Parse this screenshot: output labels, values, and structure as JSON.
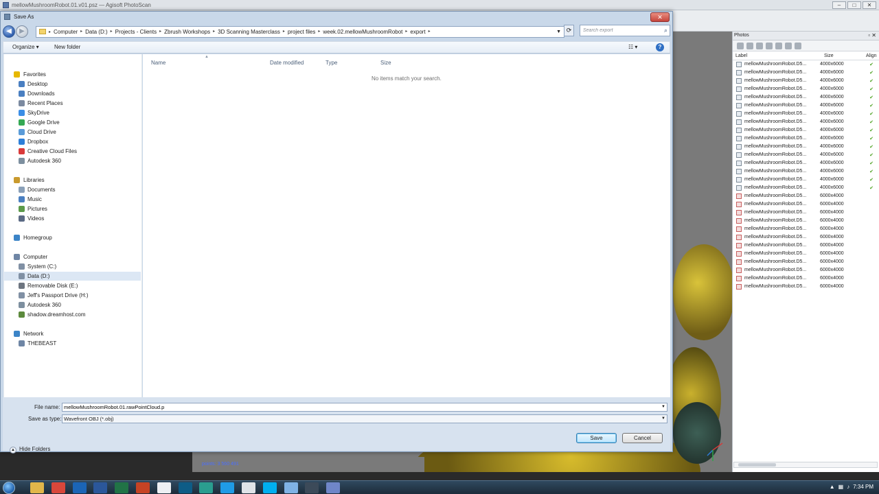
{
  "app": {
    "title": "mellowMushroomRobot.01.v01.psz — Agisoft PhotoScan",
    "points_label": "points: 3 560 491"
  },
  "photos": {
    "title": "Photos",
    "columns": [
      "Label",
      "Size",
      "Align"
    ],
    "rows": [
      {
        "label": "mellowMushroomRobot.D5...",
        "size": "4000x6000",
        "aligned": true
      },
      {
        "label": "mellowMushroomRobot.D5...",
        "size": "4000x6000",
        "aligned": true
      },
      {
        "label": "mellowMushroomRobot.D5...",
        "size": "4000x6000",
        "aligned": true
      },
      {
        "label": "mellowMushroomRobot.D5...",
        "size": "4000x6000",
        "aligned": true
      },
      {
        "label": "mellowMushroomRobot.D5...",
        "size": "4000x6000",
        "aligned": true
      },
      {
        "label": "mellowMushroomRobot.D5...",
        "size": "4000x6000",
        "aligned": true
      },
      {
        "label": "mellowMushroomRobot.D5...",
        "size": "4000x6000",
        "aligned": true
      },
      {
        "label": "mellowMushroomRobot.D5...",
        "size": "4000x6000",
        "aligned": true
      },
      {
        "label": "mellowMushroomRobot.D5...",
        "size": "4000x6000",
        "aligned": true
      },
      {
        "label": "mellowMushroomRobot.D5...",
        "size": "4000x6000",
        "aligned": true
      },
      {
        "label": "mellowMushroomRobot.D5...",
        "size": "4000x6000",
        "aligned": true
      },
      {
        "label": "mellowMushroomRobot.D5...",
        "size": "4000x6000",
        "aligned": true
      },
      {
        "label": "mellowMushroomRobot.D5...",
        "size": "4000x6000",
        "aligned": true
      },
      {
        "label": "mellowMushroomRobot.D5...",
        "size": "4000x6000",
        "aligned": true
      },
      {
        "label": "mellowMushroomRobot.D5...",
        "size": "4000x6000",
        "aligned": true
      },
      {
        "label": "mellowMushroomRobot.D5...",
        "size": "4000x6000",
        "aligned": true
      },
      {
        "label": "mellowMushroomRobot.D5...",
        "size": "6000x4000",
        "aligned": false
      },
      {
        "label": "mellowMushroomRobot.D5...",
        "size": "6000x4000",
        "aligned": false
      },
      {
        "label": "mellowMushroomRobot.D5...",
        "size": "6000x4000",
        "aligned": false
      },
      {
        "label": "mellowMushroomRobot.D5...",
        "size": "6000x4000",
        "aligned": false
      },
      {
        "label": "mellowMushroomRobot.D5...",
        "size": "6000x4000",
        "aligned": false
      },
      {
        "label": "mellowMushroomRobot.D5...",
        "size": "6000x4000",
        "aligned": false
      },
      {
        "label": "mellowMushroomRobot.D5...",
        "size": "6000x4000",
        "aligned": false
      },
      {
        "label": "mellowMushroomRobot.D5...",
        "size": "6000x4000",
        "aligned": false
      },
      {
        "label": "mellowMushroomRobot.D5...",
        "size": "6000x4000",
        "aligned": false
      },
      {
        "label": "mellowMushroomRobot.D5...",
        "size": "6000x4000",
        "aligned": false
      },
      {
        "label": "mellowMushroomRobot.D5...",
        "size": "6000x4000",
        "aligned": false
      },
      {
        "label": "mellowMushroomRobot.D5...",
        "size": "6000x4000",
        "aligned": false
      }
    ]
  },
  "dialog": {
    "title": "Save As",
    "breadcrumb": [
      "Computer",
      "Data (D:)",
      "Projects - Clients",
      "Zbrush Workshops",
      "3D Scanning Masterclass",
      "project files",
      "week.02.mellowMushroomRobot",
      "export"
    ],
    "search_placeholder": "Search export",
    "toolbar": {
      "organize": "Organize ▾",
      "new_folder": "New folder"
    },
    "nav_items": [
      {
        "label": "Favorites",
        "level": "group",
        "icon": "star-icon",
        "color": "#e6b800"
      },
      {
        "label": "Desktop",
        "level": "child",
        "icon": "desktop-icon",
        "color": "#4a7fc1"
      },
      {
        "label": "Downloads",
        "level": "child",
        "icon": "downloads-icon",
        "color": "#4a7fc1"
      },
      {
        "label": "Recent Places",
        "level": "child",
        "icon": "recent-places-icon",
        "color": "#7b8aa0"
      },
      {
        "label": "SkyDrive",
        "level": "child",
        "icon": "cloud-icon",
        "color": "#3b8ee6"
      },
      {
        "label": "Google Drive",
        "level": "child",
        "icon": "google-drive-icon",
        "color": "#34a853"
      },
      {
        "label": "Cloud Drive",
        "level": "child",
        "icon": "cloud-icon",
        "color": "#5a9bd8"
      },
      {
        "label": "Dropbox",
        "level": "child",
        "icon": "dropbox-icon",
        "color": "#2d7fd8"
      },
      {
        "label": "Creative Cloud Files",
        "level": "child",
        "icon": "creative-cloud-icon",
        "color": "#d93a3a"
      },
      {
        "label": "Autodesk 360",
        "level": "child",
        "icon": "autodesk-icon",
        "color": "#7d8f9f"
      },
      {
        "label": "Libraries",
        "level": "group",
        "icon": "libraries-icon",
        "color": "#c99a2e"
      },
      {
        "label": "Documents",
        "level": "child",
        "icon": "documents-icon",
        "color": "#8aa0b8"
      },
      {
        "label": "Music",
        "level": "child",
        "icon": "music-icon",
        "color": "#4a7fc1"
      },
      {
        "label": "Pictures",
        "level": "child",
        "icon": "pictures-icon",
        "color": "#5c9a4a"
      },
      {
        "label": "Videos",
        "level": "child",
        "icon": "videos-icon",
        "color": "#5b6a84"
      },
      {
        "label": "Homegroup",
        "level": "group",
        "icon": "homegroup-icon",
        "color": "#3c84c7"
      },
      {
        "label": "Computer",
        "level": "group",
        "icon": "computer-icon",
        "color": "#6f86a5"
      },
      {
        "label": "System (C:)",
        "level": "child",
        "icon": "drive-icon",
        "color": "#8090a4"
      },
      {
        "label": "Data (D:)",
        "level": "child",
        "icon": "drive-icon",
        "color": "#8090a4",
        "selected": true
      },
      {
        "label": "Removable Disk (E:)",
        "level": "child",
        "icon": "usb-drive-icon",
        "color": "#6d7580"
      },
      {
        "label": "Jeff's Passport Drive (H:)",
        "level": "child",
        "icon": "drive-icon",
        "color": "#8090a4"
      },
      {
        "label": "Autodesk 360",
        "level": "child",
        "icon": "autodesk-icon",
        "color": "#7d8f9f"
      },
      {
        "label": "shadow.dreamhost.com",
        "level": "child",
        "icon": "network-drive-icon",
        "color": "#5c8a3d"
      },
      {
        "label": "Network",
        "level": "group",
        "icon": "network-icon",
        "color": "#3c84c7"
      },
      {
        "label": "THEBEAST",
        "level": "child",
        "icon": "computer-icon",
        "color": "#6f86a5"
      }
    ],
    "columns": {
      "name": "Name",
      "date_modified": "Date modified",
      "type": "Type",
      "size": "Size"
    },
    "empty_message": "No items match your search.",
    "file_name_label": "File name:",
    "file_name_value": "mellowMushroomRobot.01.rawPointCloud.p",
    "save_type_label": "Save as type:",
    "save_type_value": "Wavefront OBJ (*.obj)",
    "hide_folders": "Hide Folders",
    "save_button": "Save",
    "cancel_button": "Cancel"
  },
  "taskbar": {
    "apps": [
      {
        "name": "explorer-task-icon",
        "color": "#e1b64a"
      },
      {
        "name": "chrome-task-icon",
        "color": "#d8473b"
      },
      {
        "name": "outlook-task-icon",
        "color": "#1b65b6"
      },
      {
        "name": "word-task-icon",
        "color": "#2b579a"
      },
      {
        "name": "excel-task-icon",
        "color": "#217346"
      },
      {
        "name": "powerpoint-task-icon",
        "color": "#c64324"
      },
      {
        "name": "notepad-task-icon",
        "color": "#eceff3"
      },
      {
        "name": "photoshop-task-icon",
        "color": "#0e5c86"
      },
      {
        "name": "photoscan-task-icon",
        "color": "#2a9d8f"
      },
      {
        "name": "sketch-task-icon",
        "color": "#1f9be6"
      },
      {
        "name": "snipping-task-icon",
        "color": "#dfe3e8"
      },
      {
        "name": "skype-task-icon",
        "color": "#00aff0"
      },
      {
        "name": "snowflake-task-icon",
        "color": "#7fb2e5"
      },
      {
        "name": "terminal-task-icon",
        "color": "#3c4a59"
      },
      {
        "name": "photoscan-active-task-icon",
        "color": "#6f86c8"
      }
    ],
    "clock": "7:34 PM"
  }
}
